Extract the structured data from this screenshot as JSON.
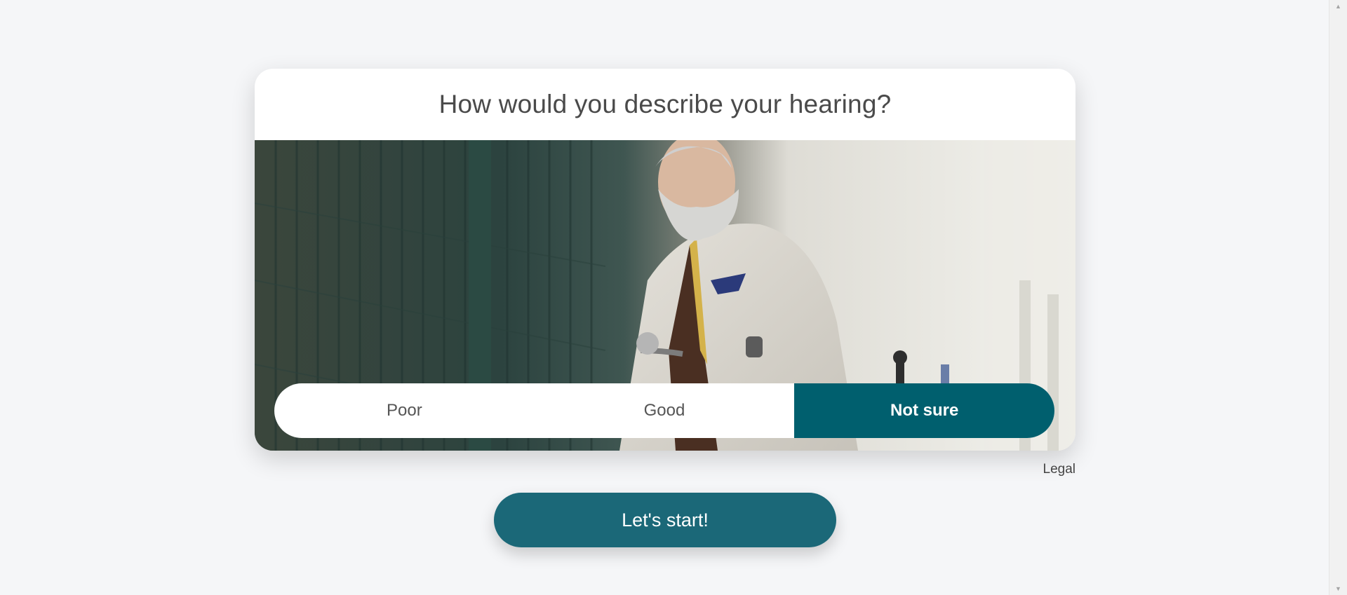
{
  "question": {
    "title": "How would you describe your hearing?"
  },
  "hero_image": {
    "alt": "Older man with white beard in light suit holding a bicycle"
  },
  "options": {
    "items": [
      {
        "label": "Poor",
        "selected": false
      },
      {
        "label": "Good",
        "selected": false
      },
      {
        "label": "Not sure",
        "selected": true
      }
    ]
  },
  "legal": {
    "label": "Legal"
  },
  "cta": {
    "label": "Let's start!"
  },
  "colors": {
    "page_background": "#f5f6f8",
    "selected_option": "#005f6e",
    "cta_button": "#1b6878"
  },
  "scrollbar": {
    "up_icon": "arrow-up-icon",
    "down_icon": "arrow-down-icon"
  }
}
